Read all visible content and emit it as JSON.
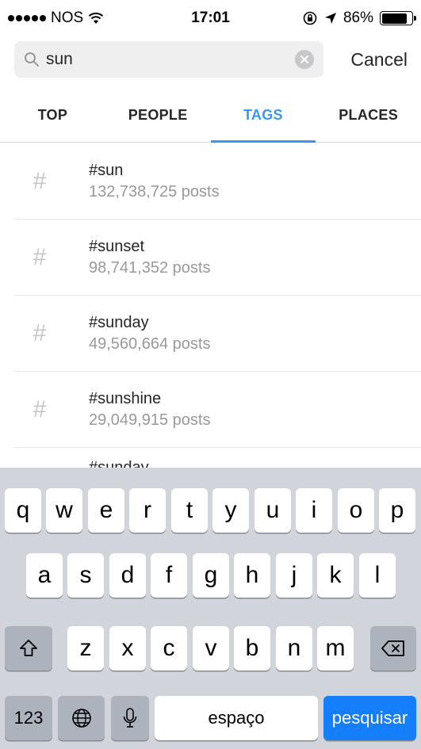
{
  "status_bar": {
    "carrier": "NOS",
    "time": "17:01",
    "battery_percent": "86%",
    "battery_level": 0.86
  },
  "search": {
    "query": "sun",
    "cancel_label": "Cancel"
  },
  "tabs": [
    {
      "label": "TOP",
      "active": false
    },
    {
      "label": "PEOPLE",
      "active": false
    },
    {
      "label": "TAGS",
      "active": true
    },
    {
      "label": "PLACES",
      "active": false
    }
  ],
  "results": [
    {
      "tag": "#sun",
      "count": "132,738,725 posts"
    },
    {
      "tag": "#sunset",
      "count": "98,741,352 posts"
    },
    {
      "tag": "#sunday",
      "count": "49,560,664 posts"
    },
    {
      "tag": "#sunshine",
      "count": "29,049,915 posts"
    }
  ],
  "partial_result": "#sunday",
  "keyboard": {
    "row1": [
      "q",
      "w",
      "e",
      "r",
      "t",
      "y",
      "u",
      "i",
      "o",
      "p"
    ],
    "row2": [
      "a",
      "s",
      "d",
      "f",
      "g",
      "h",
      "j",
      "k",
      "l"
    ],
    "row3": [
      "z",
      "x",
      "c",
      "v",
      "b",
      "n",
      "m"
    ],
    "numbers_label": "123",
    "space_label": "espaço",
    "search_label": "pesquisar"
  },
  "colors": {
    "accent": "#3897f0",
    "keyboard_bg": "#d1d5db",
    "search_key": "#147efb"
  }
}
